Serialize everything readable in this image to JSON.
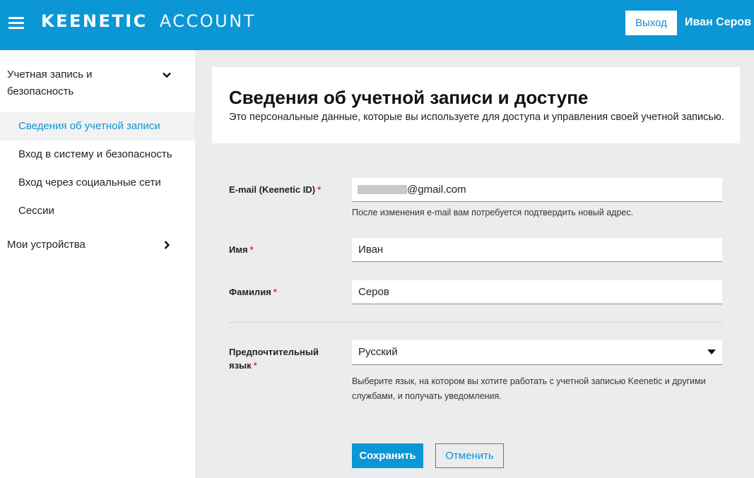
{
  "header": {
    "logo_bold": "KEENETIC",
    "logo_thin": "ACCOUNT",
    "logout_label": "Выход",
    "user_name": "Иван Серов",
    "accent_color": "#0b96d6"
  },
  "sidebar": {
    "group1_label": "Учетная запись и безопасность",
    "items": [
      {
        "label": "Сведения об учетной записи",
        "active": true
      },
      {
        "label": "Вход в систему и безопасность"
      },
      {
        "label": "Вход через социальные сети"
      },
      {
        "label": "Сессии"
      }
    ],
    "group2_label": "Мои устройства"
  },
  "page": {
    "title": "Сведения об учетной записи и доступе",
    "subtitle": "Это персональные данные, которые вы используете для доступа и управления своей учетной записью."
  },
  "form": {
    "email": {
      "label": "E-mail (Keenetic ID)",
      "required_mark": "*",
      "value_visible": "@gmail.com",
      "hint": "После изменения e-mail вам потребуется подтвердить новый адрес."
    },
    "first_name": {
      "label": "Имя",
      "required_mark": "*",
      "value": "Иван"
    },
    "last_name": {
      "label": "Фамилия",
      "required_mark": "*",
      "value": "Серов"
    },
    "language": {
      "label_line1": "Предпочтительный",
      "label_line2": "язык",
      "required_mark": "*",
      "value": "Русский",
      "hint_line1": "Выберите язык, на котором вы хотите работать с учетной записью Keenetic и другими",
      "hint_line2": "службами, и получать уведомления."
    },
    "save_label": "Сохранить",
    "cancel_label": "Отменить"
  }
}
